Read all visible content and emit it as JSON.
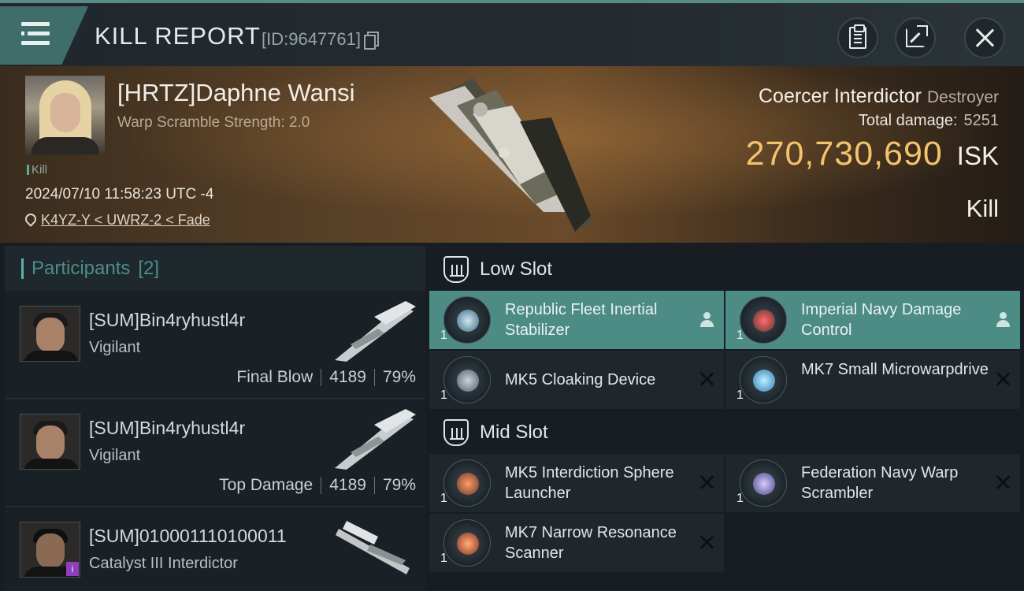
{
  "header": {
    "title": "KILL REPORT",
    "report_id": "[ID:9647761]"
  },
  "victim": {
    "name": "[HRTZ]Daphne Wansi",
    "subtitle": "Warp Scramble Strength: 2.0",
    "tag": "Kill",
    "datetime": "2024/07/10 11:58:23 UTC -4",
    "location": "K4YZ-Y < UWRZ-2 < Fade",
    "ship_name": "Coercer Interdictor",
    "ship_class": "Destroyer",
    "total_damage_label": "Total damage:",
    "total_damage": "5251",
    "isk_value": "270,730,690",
    "isk_unit": "ISK",
    "result": "Kill"
  },
  "participants": {
    "label": "Participants",
    "count": "[2]",
    "rows": [
      {
        "name": "[SUM]Bin4ryhustl4r",
        "ship": "Vigilant",
        "role": "Final Blow",
        "damage": "4189",
        "percent": "79%"
      },
      {
        "name": "[SUM]Bin4ryhustl4r",
        "ship": "Vigilant",
        "role": "Top Damage",
        "damage": "4189",
        "percent": "79%"
      },
      {
        "name": "[SUM]010001110100011",
        "ship": "Catalyst III Interdictor",
        "badge": "i"
      }
    ]
  },
  "fitting": {
    "low_slot_label": "Low Slot",
    "mid_slot_label": "Mid Slot",
    "low": [
      {
        "name": "Republic Fleet Inertial Stabilizer",
        "qty": "1",
        "status": "dropped"
      },
      {
        "name": "Imperial Navy Damage Control",
        "qty": "1",
        "status": "dropped"
      },
      {
        "name": "MK5 Cloaking Device",
        "qty": "1",
        "status": "destroyed"
      },
      {
        "name": "MK7 Small Microwarpdrive",
        "qty": "1",
        "status": "destroyed"
      }
    ],
    "mid": [
      {
        "name": "MK5 Interdiction Sphere Launcher",
        "qty": "1",
        "status": "destroyed"
      },
      {
        "name": "Federation Navy Warp Scrambler",
        "qty": "1",
        "status": "destroyed"
      },
      {
        "name": "MK7 Narrow Resonance Scanner",
        "qty": "1",
        "status": "destroyed"
      }
    ]
  },
  "icons": {
    "menu": "hamburger-icon",
    "copy": "copy-icon",
    "clipboard": "clipboard-icon",
    "share": "share-icon",
    "close": "close-icon",
    "location": "location-pin-icon",
    "slot": "slot-icon",
    "dropped": "person-icon",
    "destroyed": "x-icon"
  },
  "colors": {
    "accent_teal": "#4d8b85",
    "isk_gold": "#f3c46c",
    "panel": "#1f272c"
  }
}
